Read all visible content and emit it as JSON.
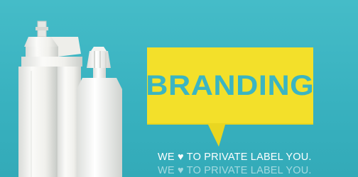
{
  "banner": {
    "headline": "BRANDING",
    "tagline_pre": "WE",
    "tagline_post": "TO PRIVATE LABEL YOU.",
    "heart_icon": "heart-icon",
    "heart_glyph": "♥"
  },
  "colors": {
    "background": "#3bb5c2",
    "speech_bubble": "#f3e02a",
    "headline_cutout": "#3bb5c2",
    "cartridge": "#f2f2ef",
    "tagline": "#ffffff"
  }
}
